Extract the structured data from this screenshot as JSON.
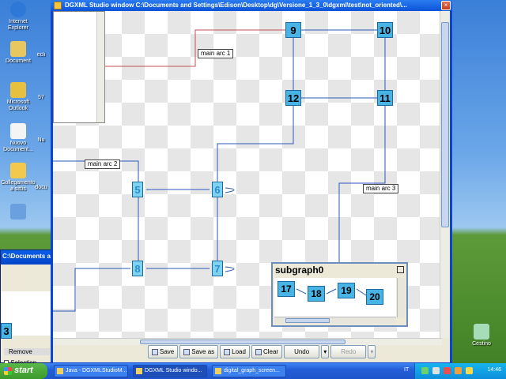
{
  "desktop": {
    "icons_left": [
      {
        "label": "Internet Explorer"
      },
      {
        "label": "Document"
      },
      {
        "label": "Microsoft Outlook"
      },
      {
        "label": "Nuovo Document..."
      },
      {
        "label": "Collegamento a sittis"
      },
      {
        "label": ""
      }
    ],
    "icons_col2": [
      {
        "label": "ecli"
      },
      {
        "label": "57"
      },
      {
        "label": "Nu"
      },
      {
        "label": "docu"
      }
    ],
    "recycle_bin": {
      "label": "Cestino"
    }
  },
  "bg_window": {
    "title": "C:\\Documents and",
    "menu_remove": "Remove",
    "menu_selection": "Selection",
    "node_label": "3"
  },
  "window": {
    "title": "DGXML Studio window C:\\Documents and Settings\\Edison\\Desktop\\dg\\Versione_1_3_0\\dgxml\\test\\not_oriented\\...",
    "controls": {
      "minimize": "_",
      "maximize": "□",
      "close": "×"
    }
  },
  "graph": {
    "nodes": [
      {
        "id": "9",
        "style": "dark"
      },
      {
        "id": "10",
        "style": "dark"
      },
      {
        "id": "12",
        "style": "dark"
      },
      {
        "id": "11",
        "style": "dark"
      },
      {
        "id": "5",
        "style": "light"
      },
      {
        "id": "6",
        "style": "light"
      },
      {
        "id": "8",
        "style": "light"
      },
      {
        "id": "7",
        "style": "light"
      }
    ],
    "arc_labels": {
      "arc1": "main arc 1",
      "arc2": "main arc 2",
      "arc3": "main arc 3"
    }
  },
  "subgraph": {
    "title": "subgraph0",
    "nodes": [
      "17",
      "18",
      "19",
      "20"
    ]
  },
  "toolbar": {
    "save": "Save",
    "save_as": "Save as",
    "load": "Load",
    "clear": "Clear",
    "undo": "Undo",
    "redo": "Redo"
  },
  "taskbar": {
    "start": "start",
    "tasks": [
      "Java - DGXMLStudioM...",
      "DGXML Studio windo...",
      "digital_graph_screen..."
    ],
    "lang": "IT",
    "clock": "14:46"
  }
}
